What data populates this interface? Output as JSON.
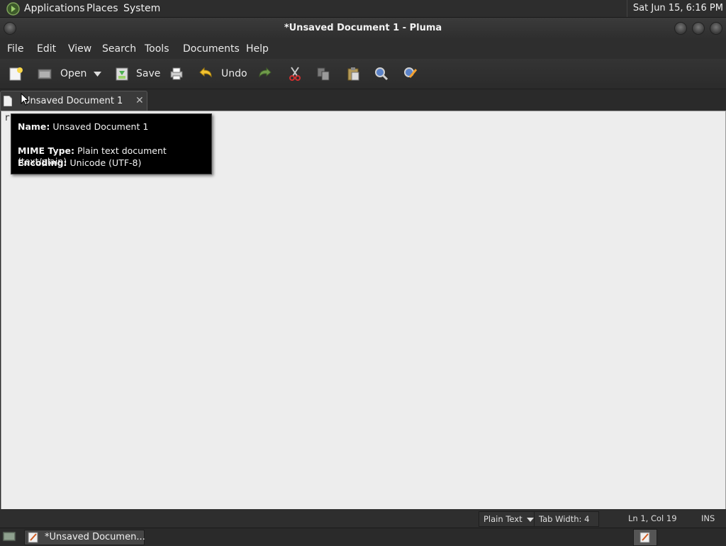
{
  "top_panel": {
    "menus": [
      "Applications",
      "Places",
      "System"
    ],
    "clock": "Sat Jun 15,  6:16 PM"
  },
  "window": {
    "title": "*Unsaved Document 1 - Pluma"
  },
  "menubar": [
    "File",
    "Edit",
    "View",
    "Search",
    "Tools",
    "Documents",
    "Help"
  ],
  "toolbar": {
    "open_label": "Open",
    "save_label": "Save",
    "undo_label": "Undo",
    "icons": [
      "new-document-icon",
      "open-icon",
      "dropdown-arrow-icon",
      "save-icon",
      "print-icon",
      "undo-icon",
      "redo-icon",
      "cut-icon",
      "copy-icon",
      "paste-icon",
      "find-icon",
      "replace-icon"
    ]
  },
  "tab": {
    "label": "Unsaved Document 1",
    "close": "✕"
  },
  "editor": {
    "text": "r"
  },
  "tooltip": {
    "name_key": "Name:",
    "name_val": " Unsaved Document 1",
    "mime_key": "MIME Type:",
    "mime_val": " Plain text document (text/plain)",
    "enc_key": "Encoding:",
    "enc_val": " Unicode (UTF-8)"
  },
  "statusbar": {
    "language": "Plain Text",
    "tab_width": "Tab Width:  4",
    "position": "Ln 1, Col 19",
    "mode": "INS"
  },
  "taskbar": {
    "task_label": "*Unsaved Documen..."
  },
  "colors": {
    "editor_bg": "#ededed",
    "panel_bg": "#2d2d2d",
    "tooltip_bg": "#000000"
  }
}
